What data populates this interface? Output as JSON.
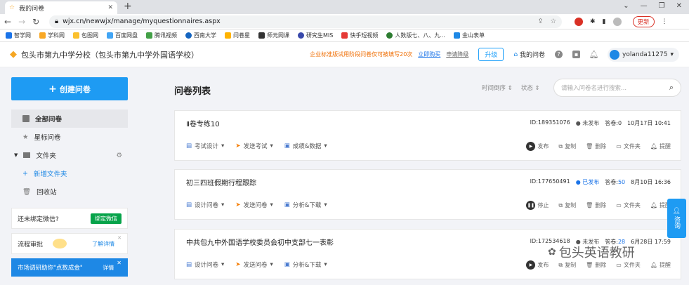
{
  "browser": {
    "tab_title": "我的问卷",
    "url": "wjx.cn/newwjx/manage/myquestionnaires.aspx",
    "update_label": "更新",
    "bookmarks": [
      "智学网",
      "学科网",
      "包图网",
      "百度网盘",
      "腾讯视频",
      "西南大学",
      "问卷星",
      "师元网课",
      "研究生MIS",
      "快手短视频",
      "人数版七、八、九...",
      "金山表单"
    ]
  },
  "header": {
    "org_title": "包头市第九中学分校（包头市第九中学外国语学校）",
    "promo": "企业标准版试用阶段问卷仅可被填写20次",
    "buy_link": "立即购买",
    "downgrade_link": "申请降级",
    "upgrade_label": "升级",
    "my_questionnaires": "我的问卷",
    "username": "yolanda11275"
  },
  "sidebar": {
    "create_label": "创建问卷",
    "items": [
      "全部问卷",
      "星标问卷",
      "文件夹",
      "新增文件夹",
      "回收站"
    ],
    "wechat_text": "还未绑定微信?",
    "wechat_button": "绑定微信",
    "flow_text": "流程审批",
    "flow_link": "了解详情",
    "promo_text": "市场调研助你\"点数成金\"",
    "promo_link": "详情"
  },
  "main": {
    "title": "问卷列表",
    "sort_time": "时间倒序",
    "sort_status": "状态",
    "search_placeholder": "请输入问卷名进行搜索...",
    "questionnaires": [
      {
        "title": "Ⅱ卷专练10",
        "id": "ID:189351076",
        "status": "未发布",
        "answers_label": "答卷:",
        "answers": "0",
        "date": "10月17日 10:41",
        "ops": [
          "考试设计",
          "发送考试",
          "成绩&数据"
        ],
        "primary_action": "发布"
      },
      {
        "title": "初三四班假期行程跟踪",
        "id": "ID:177650491",
        "status": "已发布",
        "answers_label": "答卷:",
        "answers": "50",
        "date": "8月10日 16:36",
        "ops": [
          "设计问卷",
          "发送问卷",
          "分析&下载"
        ],
        "primary_action": "停止"
      },
      {
        "title": "中共包九中外国语学校委员会初中支部七一表彰",
        "id": "ID:172534618",
        "status": "未发布",
        "answers_label": "答卷:",
        "answers": "28",
        "date": "6月28日 17:59",
        "ops": [
          "设计问卷",
          "发送问卷",
          "分析&下载"
        ],
        "primary_action": "发布"
      }
    ],
    "actions": [
      "复制",
      "删除",
      "文件夹",
      "提醒"
    ]
  },
  "consult_label": "咨询",
  "watermark": "包头英语教研"
}
